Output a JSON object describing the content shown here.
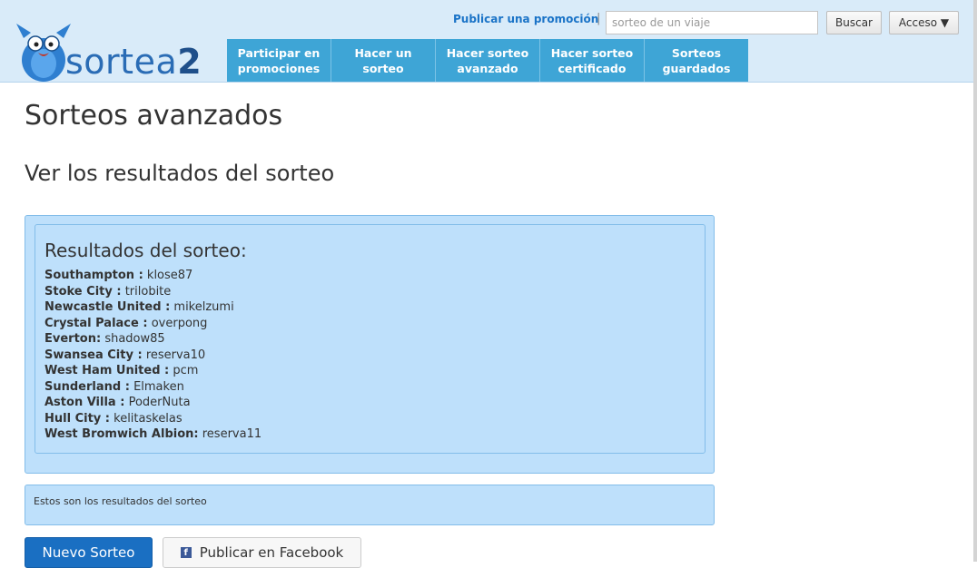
{
  "header": {
    "logo_text": "sortea",
    "logo_suffix": "2",
    "publish_link": "Publicar una promoción",
    "separator": "|",
    "search_placeholder": "sorteo de un viaje",
    "search_button": "Buscar",
    "access_button": "Acceso ▼"
  },
  "nav": [
    {
      "line1": "Participar en",
      "line2": "promociones"
    },
    {
      "line1": "Hacer un",
      "line2": "sorteo"
    },
    {
      "line1": "Hacer sorteo",
      "line2": "avanzado"
    },
    {
      "line1": "Hacer sorteo",
      "line2": "certificado"
    },
    {
      "line1": "Sorteos",
      "line2": "guardados"
    }
  ],
  "main": {
    "page_title": "Sorteos avanzados",
    "sub_title": "Ver los resultados del sorteo",
    "results_heading": "Resultados del sorteo:",
    "results": [
      {
        "team": "Southampton :",
        "user": "klose87"
      },
      {
        "team": "Stoke City :",
        "user": "trilobite"
      },
      {
        "team": "Newcastle United :",
        "user": "mikelzumi"
      },
      {
        "team": "Crystal Palace :",
        "user": "overpong"
      },
      {
        "team": "Everton:",
        "user": "shadow85"
      },
      {
        "team": "Swansea City :",
        "user": "reserva10"
      },
      {
        "team": "West Ham United :",
        "user": "pcm"
      },
      {
        "team": "Sunderland :",
        "user": "Elmaken"
      },
      {
        "team": "Aston Villa :",
        "user": "PoderNuta"
      },
      {
        "team": "Hull City :",
        "user": "kelitaskelas"
      },
      {
        "team": "West Bromwich Albion:",
        "user": "reserva11"
      }
    ],
    "message": "Estos son los resultados del sorteo",
    "new_draw_button": "Nuevo Sorteo",
    "facebook_button": "Publicar en Facebook",
    "facebook_icon_glyph": "f"
  },
  "colors": {
    "header_bg": "#d9ebf9",
    "nav_bg": "#3ea5d6",
    "box_bg": "#bee0fb",
    "primary_button": "#1a6fc2",
    "link": "#1a73c7"
  }
}
